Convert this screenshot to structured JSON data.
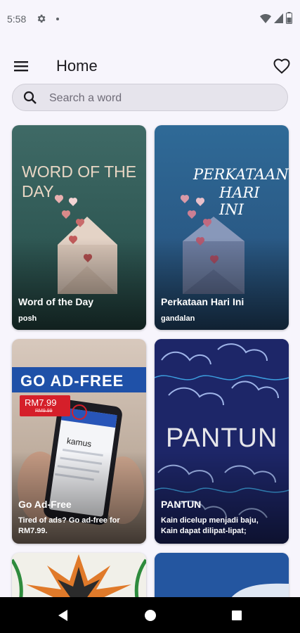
{
  "status_bar": {
    "time": "5:58",
    "icons": [
      "gear-icon",
      "notification-dot",
      "wifi-icon",
      "cell-signal-icon",
      "battery-icon"
    ]
  },
  "app_bar": {
    "title": "Home",
    "menu_icon": "hamburger-menu-icon",
    "favorite_icon": "heart-outline-icon"
  },
  "search": {
    "placeholder": "Search a word",
    "value": "",
    "icon": "search-icon"
  },
  "cards": [
    {
      "title": "Word of the Day",
      "subtitle": "posh",
      "art_text": "WORD OF THE DAY",
      "colors": {
        "bg": "#2e5753",
        "text": "#e9d6c4"
      }
    },
    {
      "title": "Perkataan Hari Ini",
      "subtitle": "gandalan",
      "art_text_line1": "PERKATAAN",
      "art_text_line2": "HARI INI",
      "colors": {
        "bg": "#2a5a86",
        "text": "#ffffff"
      }
    },
    {
      "title": "Go Ad-Free",
      "subtitle": "Tired of ads? Go ad-free for RM7.99.",
      "banner": "GO AD-FREE",
      "price": "RM7.99",
      "old_price": "RM9.99",
      "phone_app_word": "kamus",
      "colors": {
        "banner": "#1f51a8",
        "price_tag": "#d51f2a"
      }
    },
    {
      "title": "PANTUN",
      "subtitle_line1": "Kain dicelup menjadi baju,",
      "subtitle_line2": "Kain dapat dilipat-lipat;",
      "art_text": "PANTUN",
      "colors": {
        "bg": "#1d2668"
      }
    },
    {
      "title": "",
      "colors": {
        "bg": "#f1f0e9"
      }
    },
    {
      "title": "",
      "colors": {
        "bg": "#2456a0"
      }
    }
  ],
  "nav_bar": {
    "icons": [
      "back-icon",
      "home-icon",
      "recents-icon"
    ]
  }
}
